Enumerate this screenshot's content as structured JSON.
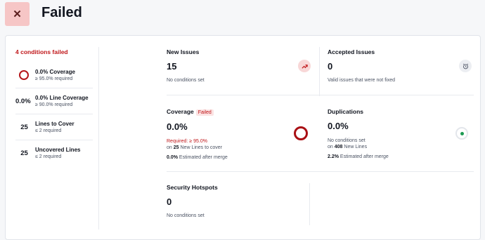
{
  "header": {
    "title": "Failed",
    "status_icon": "close-icon",
    "status_glyph": "✕"
  },
  "sidebar": {
    "fail_count": "4 conditions failed",
    "conditions": [
      {
        "indicator": "",
        "name": "0.0% Coverage",
        "requirement": "≥ 95.0% required"
      },
      {
        "indicator": "0.0%",
        "name": "0.0% Line Coverage",
        "requirement": "≥ 90.0% required"
      },
      {
        "indicator": "25",
        "name": "Lines to Cover",
        "requirement": "≤ 2 required"
      },
      {
        "indicator": "25",
        "name": "Uncovered Lines",
        "requirement": "≤ 2 required"
      }
    ]
  },
  "metrics": {
    "new_issues": {
      "title": "New Issues",
      "value": "15",
      "note": "No conditions set",
      "icon": "trend-arrow-icon"
    },
    "accepted_issues": {
      "title": "Accepted Issues",
      "value": "0",
      "note": "Valid issues that were not fixed",
      "icon": "alarm-clock-icon"
    },
    "coverage": {
      "title": "Coverage",
      "badge": "Failed",
      "value": "0.0%",
      "required": "Required: ≥ 95.0%",
      "on_prefix": "on",
      "lines_count": "25",
      "lines_suffix": "New Lines to cover",
      "merge_value": "0.0%",
      "merge_suffix": "Estimated after merge"
    },
    "duplications": {
      "title": "Duplications",
      "value": "0.0%",
      "note": "No conditions set",
      "on_prefix": "on",
      "lines_count": "408",
      "lines_suffix": "New Lines",
      "merge_value": "2.2%",
      "merge_suffix": "Estimated after merge"
    },
    "security_hotspots": {
      "title": "Security Hotspots",
      "value": "0",
      "note": "No conditions set"
    }
  },
  "colors": {
    "fail_red": "#c0171a",
    "ring_red": "#a90f14",
    "ok_green": "#1d9a52"
  }
}
